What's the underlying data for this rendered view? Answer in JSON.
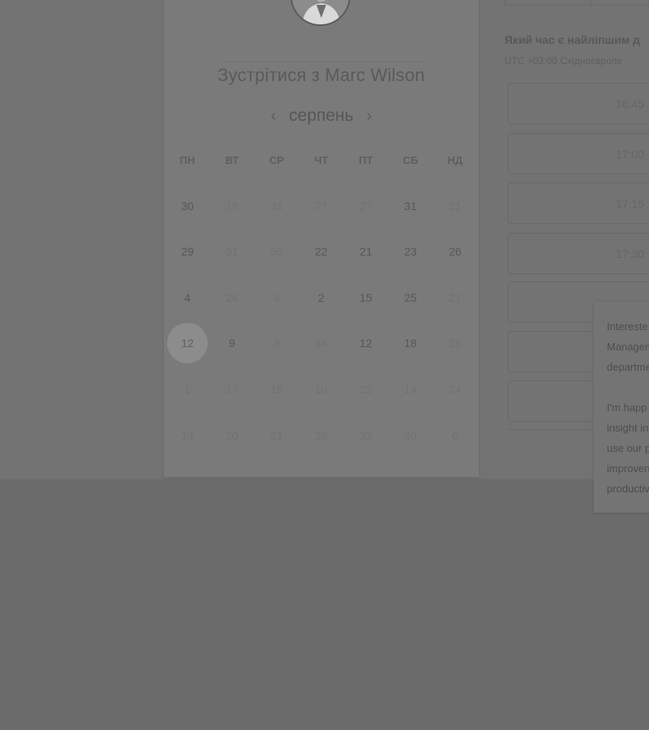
{
  "booking": {
    "title": "Зустрітися з Marc Wilson",
    "month": "серпень",
    "prev_icon": "chevron-left-icon",
    "next_icon": "chevron-right-icon"
  },
  "weekdays": [
    "ПН",
    "ВТ",
    "СР",
    "ЧТ",
    "ПТ",
    "СБ",
    "НД"
  ],
  "weeks": [
    [
      {
        "d": "30",
        "a": true
      },
      {
        "d": "19",
        "a": false
      },
      {
        "d": "31",
        "a": false
      },
      {
        "d": "27",
        "a": false
      },
      {
        "d": "27",
        "a": false
      },
      {
        "d": "31",
        "a": true
      },
      {
        "d": "31",
        "a": false
      }
    ],
    [
      {
        "d": "29",
        "a": true
      },
      {
        "d": "31",
        "a": false
      },
      {
        "d": "35",
        "a": false
      },
      {
        "d": "22",
        "a": true
      },
      {
        "d": "21",
        "a": true
      },
      {
        "d": "23",
        "a": true
      },
      {
        "d": "26",
        "a": true
      }
    ],
    [
      {
        "d": "4",
        "a": true
      },
      {
        "d": "26",
        "a": false
      },
      {
        "d": "6",
        "a": false
      },
      {
        "d": "2",
        "a": true
      },
      {
        "d": "15",
        "a": true
      },
      {
        "d": "25",
        "a": true
      },
      {
        "d": "27",
        "a": false
      }
    ],
    [
      {
        "d": "12",
        "a": true,
        "selected": true
      },
      {
        "d": "9",
        "a": true
      },
      {
        "d": "3",
        "a": false
      },
      {
        "d": "14",
        "a": false
      },
      {
        "d": "12",
        "a": true
      },
      {
        "d": "18",
        "a": true
      },
      {
        "d": "25",
        "a": false
      }
    ],
    [
      {
        "d": "1",
        "a": false
      },
      {
        "d": "17",
        "a": false
      },
      {
        "d": "16",
        "a": false
      },
      {
        "d": "10",
        "a": false
      },
      {
        "d": "22",
        "a": false
      },
      {
        "d": "14",
        "a": false
      },
      {
        "d": "24",
        "a": false
      }
    ],
    [
      {
        "d": "14",
        "a": false
      },
      {
        "d": "20",
        "a": false
      },
      {
        "d": "21",
        "a": false
      },
      {
        "d": "25",
        "a": false
      },
      {
        "d": "32",
        "a": false
      },
      {
        "d": "30",
        "a": false
      },
      {
        "d": "6",
        "a": false
      }
    ]
  ],
  "times": {
    "question": "Який час є найліпшим д",
    "timezone": "UTC +03:00 Східноєвропе",
    "slots": [
      "16:45",
      "17:00",
      "17:15",
      "17:30",
      "",
      "",
      ""
    ]
  },
  "tooltip": {
    "lines": [
      "Intereste",
      "Managem",
      "departme",
      "",
      "I'm happ",
      "insight in",
      "use our p",
      "improven",
      "productiv"
    ]
  }
}
